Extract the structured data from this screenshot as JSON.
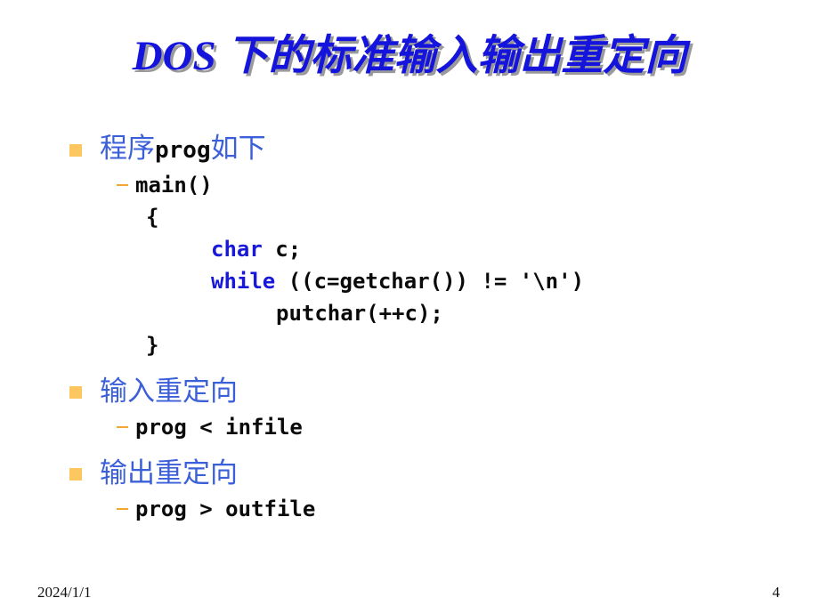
{
  "slide": {
    "title": "DOS 下的标准输入输出重定向",
    "title_color": "#1414dc",
    "title_shadow_color": "#9a9a9a"
  },
  "bullet_colors": {
    "square": "#fcc75e",
    "dash": "#f0a830",
    "heading_text": "#3b5fd9",
    "code_text": "#0a0a0a",
    "code_keyword": "#1818d8"
  },
  "content": {
    "bullet1": {
      "prefix": "程序",
      "mono": "prog",
      "suffix": "如下"
    },
    "code": {
      "line1": "main()",
      "line2": "{",
      "line3_kw": "char",
      "line3_rest": " c;",
      "line4_kw": "while",
      "line4_rest": " ((c=getchar()) != '\\n')",
      "line5": "putchar(++c);",
      "line6": "}"
    },
    "bullet2": {
      "heading": "输入重定向",
      "sub": "prog < infile"
    },
    "bullet3": {
      "heading": "输出重定向",
      "sub": "prog > outfile"
    }
  },
  "footer": {
    "date": "2024/1/1",
    "page": "4"
  }
}
